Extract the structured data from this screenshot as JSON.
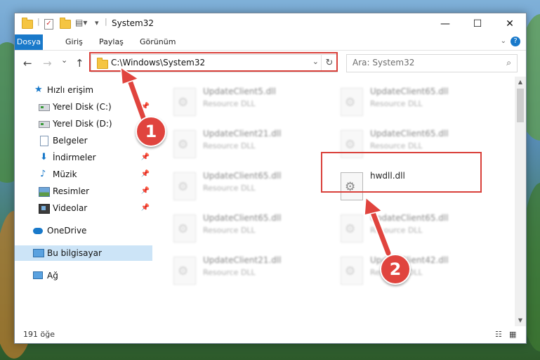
{
  "window": {
    "title": "System32",
    "controls": {
      "minimize": "—",
      "maximize": "☐",
      "close": "✕"
    }
  },
  "ribbon": {
    "tabs": [
      "Dosya",
      "Giriş",
      "Paylaş",
      "Görünüm"
    ],
    "help": "?"
  },
  "nav": {
    "back": "←",
    "forward": "→",
    "recent": "⌄",
    "up": "↑",
    "address": "C:\\Windows\\System32",
    "address_dropdown": "⌄",
    "refresh": "↻",
    "search_placeholder": "Ara: System32",
    "search_icon": "⌕"
  },
  "sidebar": {
    "items": [
      {
        "label": "Hızlı erişim",
        "icon": "star-icon",
        "pinned": false
      },
      {
        "label": "Yerel Disk (C:)",
        "icon": "drive-icon",
        "pinned": true
      },
      {
        "label": "Yerel Disk (D:)",
        "icon": "drive-icon",
        "pinned": true
      },
      {
        "label": "Belgeler",
        "icon": "documents-icon",
        "pinned": true
      },
      {
        "label": "İndirmeler",
        "icon": "downloads-icon",
        "pinned": true
      },
      {
        "label": "Müzik",
        "icon": "music-icon",
        "pinned": true
      },
      {
        "label": "Resimler",
        "icon": "pictures-icon",
        "pinned": true
      },
      {
        "label": "Videolar",
        "icon": "videos-icon",
        "pinned": true
      },
      {
        "label": "OneDrive",
        "icon": "onedrive-icon",
        "pinned": false
      },
      {
        "label": "Bu bilgisayar",
        "icon": "this-pc-icon",
        "pinned": false
      },
      {
        "label": "Ağ",
        "icon": "network-icon",
        "pinned": false
      }
    ]
  },
  "files": [
    {
      "name": "UpdateClient5.dll",
      "type": "Resource DLL"
    },
    {
      "name": "UpdateClient65.dll",
      "type": "Resource DLL"
    },
    {
      "name": "UpdateClient21.dll",
      "type": "Resource DLL"
    },
    {
      "name": "UpdateClient65.dll",
      "type": "Resource DLL"
    },
    {
      "name": "UpdateClient65.dll",
      "type": "Resource DLL"
    },
    {
      "name": "hwdll.dll",
      "type": ""
    },
    {
      "name": "UpdateClient65.dll",
      "type": "Resource DLL"
    },
    {
      "name": "UpdateClient65.dll",
      "type": "Resource DLL"
    },
    {
      "name": "UpdateClient21.dll",
      "type": "Resource DLL"
    },
    {
      "name": "UpdateClient42.dll",
      "type": "Resource DLL"
    }
  ],
  "status": {
    "count": "191 öğe"
  },
  "callouts": {
    "one": "1",
    "two": "2"
  },
  "colors": {
    "accent": "#1979ca",
    "highlight": "#d9403a",
    "callout": "#e0443e"
  }
}
